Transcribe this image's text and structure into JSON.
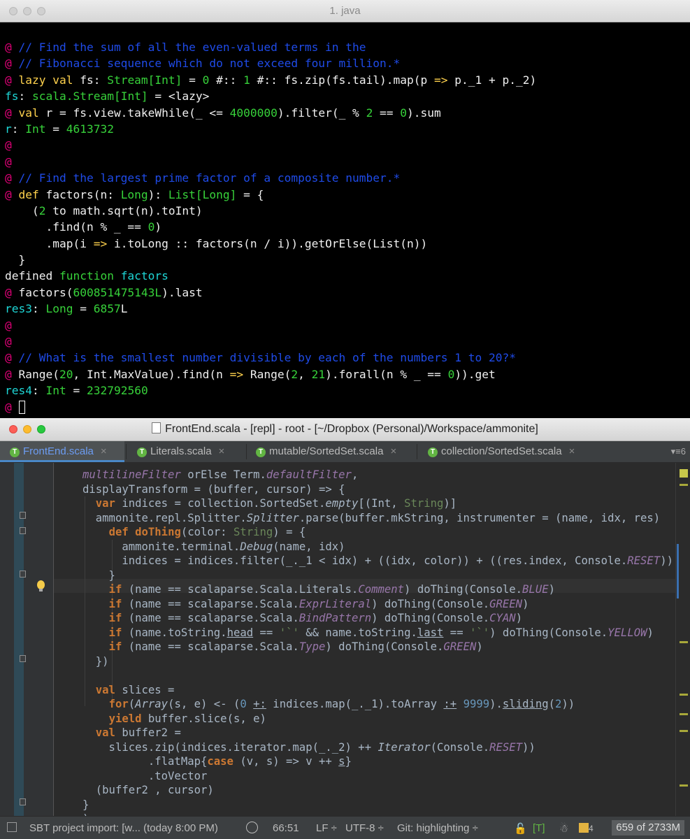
{
  "terminal": {
    "title": "1. java",
    "lines": [
      {
        "segs": [
          {
            "t": "@ ",
            "c": "pm"
          },
          {
            "t": "// Find the sum of all the even-valued terms in the",
            "c": "cm"
          }
        ]
      },
      {
        "segs": [
          {
            "t": "@ ",
            "c": "pm"
          },
          {
            "t": "// Fibonacci sequence which do not exceed four million.*",
            "c": "cm"
          }
        ]
      },
      {
        "segs": [
          {
            "t": "@ ",
            "c": "pm"
          },
          {
            "t": "lazy val ",
            "c": "kw"
          },
          {
            "t": "fs: "
          },
          {
            "t": "Stream[Int]",
            "c": "tp"
          },
          {
            "t": " = "
          },
          {
            "t": "0",
            "c": "nm"
          },
          {
            "t": " #:: "
          },
          {
            "t": "1",
            "c": "nm"
          },
          {
            "t": " #:: fs.zip(fs.tail).map(p "
          },
          {
            "t": "=>",
            "c": "kw"
          },
          {
            "t": " p._1 + p._2)"
          }
        ]
      },
      {
        "segs": [
          {
            "t": "fs",
            "c": "fnn"
          },
          {
            "t": ": "
          },
          {
            "t": "scala.Stream[Int]",
            "c": "tp"
          },
          {
            "t": " = <lazy>"
          }
        ]
      },
      {
        "segs": [
          {
            "t": "@ ",
            "c": "pm"
          },
          {
            "t": "val ",
            "c": "kw"
          },
          {
            "t": "r = fs.view.takeWhile(_ <= "
          },
          {
            "t": "4000000",
            "c": "nm"
          },
          {
            "t": ").filter(_ % "
          },
          {
            "t": "2",
            "c": "nm"
          },
          {
            "t": " == "
          },
          {
            "t": "0",
            "c": "nm"
          },
          {
            "t": ").sum"
          }
        ]
      },
      {
        "segs": [
          {
            "t": "r",
            "c": "fnn"
          },
          {
            "t": ": "
          },
          {
            "t": "Int",
            "c": "tp"
          },
          {
            "t": " = "
          },
          {
            "t": "4613732",
            "c": "nm"
          }
        ]
      },
      {
        "segs": [
          {
            "t": "@",
            "c": "pm"
          }
        ]
      },
      {
        "segs": [
          {
            "t": "@",
            "c": "pm"
          }
        ]
      },
      {
        "segs": [
          {
            "t": "@ ",
            "c": "pm"
          },
          {
            "t": "// Find the largest prime factor of a composite number.*",
            "c": "cm"
          }
        ]
      },
      {
        "segs": [
          {
            "t": "@ ",
            "c": "pm"
          },
          {
            "t": "def ",
            "c": "kw"
          },
          {
            "t": "factors(n: "
          },
          {
            "t": "Long",
            "c": "tp"
          },
          {
            "t": "): "
          },
          {
            "t": "List[Long]",
            "c": "tp"
          },
          {
            "t": " = {"
          }
        ]
      },
      {
        "segs": [
          {
            "t": "    ("
          },
          {
            "t": "2",
            "c": "nm"
          },
          {
            "t": " to math.sqrt(n).toInt)"
          }
        ]
      },
      {
        "segs": [
          {
            "t": "      .find(n % _ == "
          },
          {
            "t": "0",
            "c": "nm"
          },
          {
            "t": ")"
          }
        ]
      },
      {
        "segs": [
          {
            "t": "      .map(i "
          },
          {
            "t": "=>",
            "c": "kw"
          },
          {
            "t": " i.toLong :: factors(n / i)).getOrElse(List(n))"
          }
        ]
      },
      {
        "segs": [
          {
            "t": "  }"
          }
        ]
      },
      {
        "segs": [
          {
            "t": "defined "
          },
          {
            "t": "function ",
            "c": "tp"
          },
          {
            "t": "factors",
            "c": "fnn"
          }
        ]
      },
      {
        "segs": [
          {
            "t": "@ ",
            "c": "pm"
          },
          {
            "t": "factors("
          },
          {
            "t": "600851475143L",
            "c": "nm"
          },
          {
            "t": ").last"
          }
        ]
      },
      {
        "segs": [
          {
            "t": "res3",
            "c": "fnn"
          },
          {
            "t": ": "
          },
          {
            "t": "Long",
            "c": "tp"
          },
          {
            "t": " = "
          },
          {
            "t": "6857",
            "c": "nm"
          },
          {
            "t": "L"
          }
        ]
      },
      {
        "segs": [
          {
            "t": "@",
            "c": "pm"
          }
        ]
      },
      {
        "segs": [
          {
            "t": "@",
            "c": "pm"
          }
        ]
      },
      {
        "segs": [
          {
            "t": "@ ",
            "c": "pm"
          },
          {
            "t": "// What is the smallest number divisible by each of the numbers 1 to 20?*",
            "c": "cm"
          }
        ]
      },
      {
        "segs": [
          {
            "t": "@ ",
            "c": "pm"
          },
          {
            "t": "Range("
          },
          {
            "t": "20",
            "c": "nm"
          },
          {
            "t": ", Int.MaxValue).find(n "
          },
          {
            "t": "=>",
            "c": "kw"
          },
          {
            "t": " Range("
          },
          {
            "t": "2",
            "c": "nm"
          },
          {
            "t": ", "
          },
          {
            "t": "21",
            "c": "nm"
          },
          {
            "t": ").forall(n % _ == "
          },
          {
            "t": "0",
            "c": "nm"
          },
          {
            "t": ")).get"
          }
        ]
      },
      {
        "segs": [
          {
            "t": "res4",
            "c": "fnn"
          },
          {
            "t": ": "
          },
          {
            "t": "Int",
            "c": "tp"
          },
          {
            "t": " = "
          },
          {
            "t": "232792560",
            "c": "nm"
          }
        ]
      },
      {
        "segs": [
          {
            "t": "@ ",
            "c": "pm"
          }
        ],
        "cursor": true
      }
    ]
  },
  "ide": {
    "title": "FrontEnd.scala - [repl] - root - [~/Dropbox (Personal)/Workspace/ammonite]",
    "tabs": [
      {
        "label": "FrontEnd.scala",
        "active": true
      },
      {
        "label": "Literals.scala",
        "active": false
      },
      {
        "label": "mutable/SortedSet.scala",
        "active": false
      },
      {
        "label": "collection/SortedSet.scala",
        "active": false
      }
    ],
    "tab_icon_letter": "T",
    "tab_close": "×",
    "tabs_overflow": "▾≡6",
    "code": [
      [
        {
          "t": "multilineFilter",
          "c": "i"
        },
        {
          "t": " orElse Term."
        },
        {
          "t": "defaultFilter",
          "c": "i"
        },
        {
          "t": ","
        }
      ],
      [
        {
          "t": "displayTransform = (buffer, cursor) => {"
        }
      ],
      [
        {
          "t": "  "
        },
        {
          "t": "var ",
          "c": "k"
        },
        {
          "t": "indices = collection.SortedSet."
        },
        {
          "t": "empty",
          "c": "it"
        },
        {
          "t": "[(Int, "
        },
        {
          "t": "String",
          "c": "s"
        },
        {
          "t": ")]"
        }
      ],
      [
        {
          "t": "  ammonite.repl.Splitter."
        },
        {
          "t": "Splitter",
          "c": "it"
        },
        {
          "t": ".parse(buffer.mkString, instrumenter = (name, idx, res)"
        }
      ],
      [
        {
          "t": "    "
        },
        {
          "t": "def ",
          "c": "k"
        },
        {
          "t": "doThing",
          "c": "k"
        },
        {
          "t": "(color: "
        },
        {
          "t": "String",
          "c": "s"
        },
        {
          "t": ") = {"
        }
      ],
      [
        {
          "t": "      ammonite.terminal."
        },
        {
          "t": "Debug",
          "c": "it"
        },
        {
          "t": "(name, idx)"
        }
      ],
      [
        {
          "t": "      indices = indices.filter(_._1 < idx) + ((idx, color)) + ((res.index, Console."
        },
        {
          "t": "RESET",
          "c": "i"
        },
        {
          "t": "))"
        }
      ],
      [
        {
          "t": "    }"
        }
      ],
      [
        {
          "t": "    "
        },
        {
          "t": "if ",
          "c": "k"
        },
        {
          "t": "(name == scalaparse.Scala.Literals."
        },
        {
          "t": "Comment",
          "c": "i"
        },
        {
          "t": ") doThing(Console."
        },
        {
          "t": "BLUE",
          "c": "i"
        },
        {
          "t": ")"
        }
      ],
      [
        {
          "t": "    "
        },
        {
          "t": "if ",
          "c": "k"
        },
        {
          "t": "(name == scalaparse.Scala."
        },
        {
          "t": "ExprLiteral",
          "c": "i"
        },
        {
          "t": ") doThing(Console."
        },
        {
          "t": "GREEN",
          "c": "i"
        },
        {
          "t": ")"
        }
      ],
      [
        {
          "t": "    "
        },
        {
          "t": "if ",
          "c": "k"
        },
        {
          "t": "(name == scalaparse.Scala."
        },
        {
          "t": "BindPattern",
          "c": "i"
        },
        {
          "t": ") doThing(Console."
        },
        {
          "t": "CYAN",
          "c": "i"
        },
        {
          "t": ")"
        }
      ],
      [
        {
          "t": "    "
        },
        {
          "t": "if ",
          "c": "k"
        },
        {
          "t": "(name.toString."
        },
        {
          "t": "head",
          "c": "u"
        },
        {
          "t": " == "
        },
        {
          "t": "'`'",
          "c": "s"
        },
        {
          "t": " && name.toString."
        },
        {
          "t": "last",
          "c": "u"
        },
        {
          "t": " == "
        },
        {
          "t": "'`'",
          "c": "s"
        },
        {
          "t": ") doThing(Console."
        },
        {
          "t": "YELLOW",
          "c": "i"
        },
        {
          "t": ")"
        }
      ],
      [
        {
          "t": "    "
        },
        {
          "t": "if ",
          "c": "k"
        },
        {
          "t": "(name == scalaparse.Scala."
        },
        {
          "t": "Type",
          "c": "i"
        },
        {
          "t": ") doThing(Console."
        },
        {
          "t": "GREEN",
          "c": "i"
        },
        {
          "t": ")"
        }
      ],
      [
        {
          "t": "  })"
        }
      ],
      [
        {
          "t": ""
        }
      ],
      [
        {
          "t": "  "
        },
        {
          "t": "val ",
          "c": "k"
        },
        {
          "t": "slices ="
        }
      ],
      [
        {
          "t": "    "
        },
        {
          "t": "for",
          "c": "k"
        },
        {
          "t": "("
        },
        {
          "t": "Array",
          "c": "it"
        },
        {
          "t": "(s, e) <- ("
        },
        {
          "t": "0",
          "c": "n"
        },
        {
          "t": " "
        },
        {
          "t": "+:",
          "c": "u"
        },
        {
          "t": " indices.map(_._1).toArray "
        },
        {
          "t": ":+",
          "c": "u"
        },
        {
          "t": " "
        },
        {
          "t": "9999",
          "c": "n"
        },
        {
          "t": ")."
        },
        {
          "t": "sliding",
          "c": "u"
        },
        {
          "t": "("
        },
        {
          "t": "2",
          "c": "n"
        },
        {
          "t": "))"
        }
      ],
      [
        {
          "t": "    "
        },
        {
          "t": "yield ",
          "c": "k"
        },
        {
          "t": "buffer.slice(s, e)"
        }
      ],
      [
        {
          "t": "  "
        },
        {
          "t": "val ",
          "c": "k"
        },
        {
          "t": "buffer2 ="
        }
      ],
      [
        {
          "t": "    slices.zip(indices.iterator.map(_._2) ++ "
        },
        {
          "t": "Iterator",
          "c": "it"
        },
        {
          "t": "(Console."
        },
        {
          "t": "RESET",
          "c": "i"
        },
        {
          "t": "))"
        }
      ],
      [
        {
          "t": "          .flatMap{"
        },
        {
          "t": "case ",
          "c": "k"
        },
        {
          "t": "(v, s) => v ++ "
        },
        {
          "t": "s",
          "c": "u"
        },
        {
          "t": "}"
        }
      ],
      [
        {
          "t": "          .toVector"
        }
      ],
      [
        {
          "t": "  (buffer2 , cursor)"
        }
      ],
      [
        {
          "t": "}"
        }
      ],
      [
        {
          "t": ")"
        }
      ]
    ]
  },
  "status": {
    "task": "SBT project import: [w... (today 8:00 PM)",
    "position": "66:51",
    "line_sep": "LF ÷",
    "encoding": "UTF-8 ÷",
    "vcs": "Git: highlighting ÷",
    "lock": "🔓",
    "type_badge": "[T]",
    "hector": "☃",
    "events": "4",
    "memory": "659 of 2733M"
  },
  "colors": {
    "terminal_bg": "#000000",
    "terminal_prompt": "#e6007a",
    "terminal_comment": "#1f4be8",
    "editor_bg": "#2b2b2b",
    "keyword": "#cc7832",
    "string": "#6a8759",
    "constant": "#9876aa",
    "active_tab": "#6c9cf2"
  }
}
